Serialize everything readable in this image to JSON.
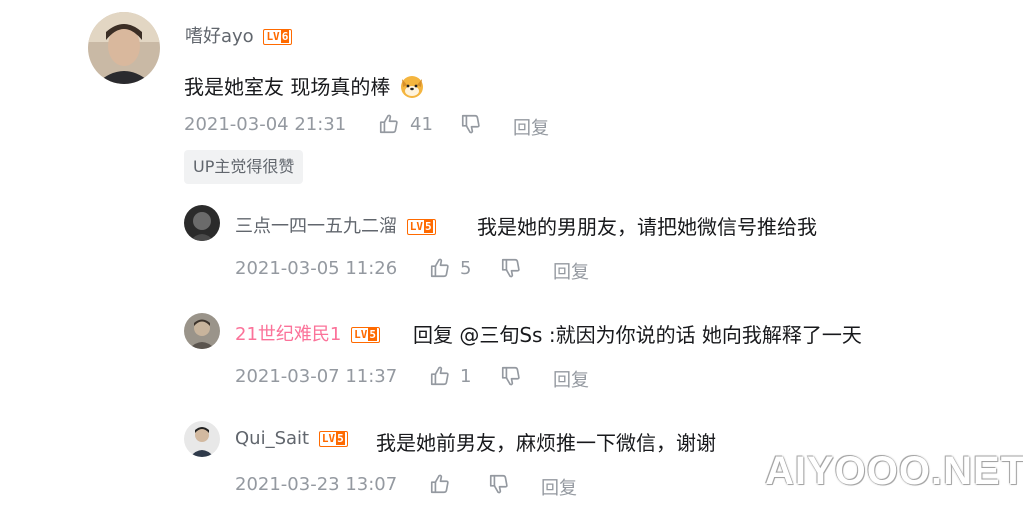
{
  "comment": {
    "username": "嗜好ayo",
    "level": "6",
    "text": "我是她室友 现场真的棒",
    "emoji": "dog-emoji",
    "time": "2021-03-04 21:31",
    "likes": "41",
    "reply_label": "回复",
    "up_badge": "UP主觉得很赞"
  },
  "replies": [
    {
      "username": "三点一四一五九二溜",
      "level": "5",
      "text": "我是她的男朋友，请把她微信号推给我",
      "time": "2021-03-05 11:26",
      "likes": "5",
      "reply_label": "回复"
    },
    {
      "username": "21世纪难民1",
      "username_color": "#fb7299",
      "level": "5",
      "text": "回复 @三旬Ss :就因为你说的话 她向我解释了一天",
      "time": "2021-03-07 11:37",
      "likes": "1",
      "reply_label": "回复"
    },
    {
      "username": "Qui_Sait",
      "level": "5",
      "text": "我是她前男友，麻烦推一下微信，谢谢",
      "time": "2021-03-23 13:07",
      "likes": "",
      "reply_label": "回复"
    }
  ],
  "level_prefix": "LV",
  "watermark": "AIYOOO.NET",
  "colors": {
    "level_badge": "#ff6a00",
    "vip_name": "#fb7299",
    "meta_text": "#9499a0"
  }
}
